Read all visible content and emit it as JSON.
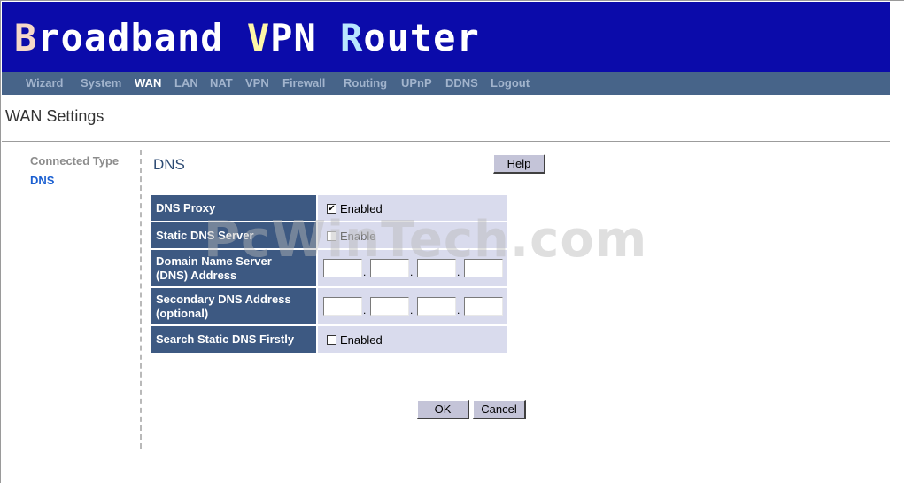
{
  "header": {
    "logo_parts": [
      "B",
      "roadband ",
      "V",
      "PN ",
      "R",
      "outer"
    ]
  },
  "nav": {
    "items": [
      "Wizard",
      "System",
      "WAN",
      "LAN",
      "NAT",
      "VPN",
      "Firewall",
      "Routing",
      "UPnP",
      "DDNS",
      "Logout"
    ],
    "active": "WAN"
  },
  "page": {
    "title": "WAN Settings"
  },
  "sidebar": {
    "items": [
      "Connected Type",
      "DNS"
    ],
    "active": "DNS"
  },
  "section": {
    "title": "DNS",
    "help_label": "Help"
  },
  "dns_table": {
    "rows": [
      {
        "label": "DNS Proxy",
        "type": "checkbox",
        "checked": true,
        "disabled": false,
        "option": "Enabled"
      },
      {
        "label": "Static DNS Server",
        "type": "checkbox",
        "checked": false,
        "disabled": true,
        "option": "Enable"
      },
      {
        "label_lines": [
          "Domain Name Server",
          "(DNS) Address"
        ],
        "type": "ip",
        "octets": [
          "",
          "",
          "",
          ""
        ]
      },
      {
        "label_lines": [
          "Secondary DNS Address",
          "(optional)"
        ],
        "type": "ip",
        "octets": [
          "",
          "",
          "",
          ""
        ]
      },
      {
        "label": "Search Static DNS Firstly",
        "type": "checkbox",
        "checked": false,
        "disabled": false,
        "option": "Enabled"
      }
    ]
  },
  "ip_separator": ".",
  "checkmark": "✔",
  "actions": {
    "ok_label": "OK",
    "cancel_label": "Cancel"
  },
  "watermark": "PcWinTech.com",
  "colors": {
    "header_bg": "#0b0baa",
    "nav_bg": "#476489",
    "label_bg": "#3d5982",
    "value_bg": "#d9dbed",
    "button_bg": "#c4c4d8"
  }
}
